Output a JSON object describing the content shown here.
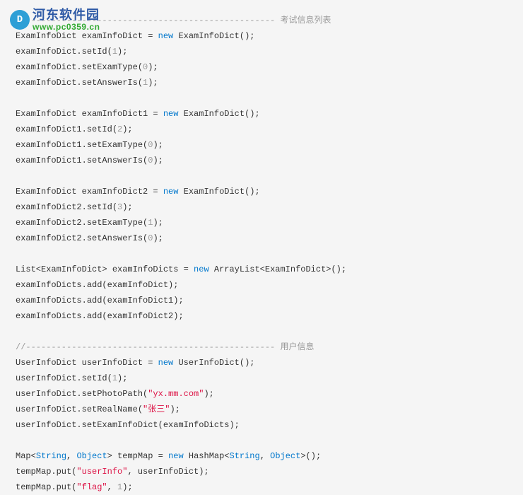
{
  "watermark": {
    "logo_glyph": "D",
    "title": "河东软件园",
    "url": "www.pc0359.cn"
  },
  "comments": {
    "exam_info": "//------------------------------------------------- 考试信息列表",
    "user_info": "//------------------------------------------------- 用户信息"
  },
  "lines": {
    "l1_a": "ExamInfoDict examInfoDict = ",
    "l1_new": "new",
    "l1_b": " ExamInfoDict();",
    "l2_a": "examInfoDict.setId(",
    "l2_n": "1",
    "l2_b": ");",
    "l3_a": "examInfoDict.setExamType(",
    "l3_n": "0",
    "l3_b": ");",
    "l4_a": "examInfoDict.setAnswerIs(",
    "l4_n": "1",
    "l4_b": ");",
    "l5_a": "ExamInfoDict examInfoDict1 = ",
    "l5_new": "new",
    "l5_b": " ExamInfoDict();",
    "l6_a": "examInfoDict1.setId(",
    "l6_n": "2",
    "l6_b": ");",
    "l7_a": "examInfoDict1.setExamType(",
    "l7_n": "0",
    "l7_b": ");",
    "l8_a": "examInfoDict1.setAnswerIs(",
    "l8_n": "0",
    "l8_b": ");",
    "l9_a": "ExamInfoDict examInfoDict2 = ",
    "l9_new": "new",
    "l9_b": " ExamInfoDict();",
    "l10_a": "examInfoDict2.setId(",
    "l10_n": "3",
    "l10_b": ");",
    "l11_a": "examInfoDict2.setExamType(",
    "l11_n": "1",
    "l11_b": ");",
    "l12_a": "examInfoDict2.setAnswerIs(",
    "l12_n": "0",
    "l12_b": ");",
    "l13_a": "List<ExamInfoDict> examInfoDicts = ",
    "l13_new": "new",
    "l13_b": " ArrayList<ExamInfoDict>();",
    "l14": "examInfoDicts.add(examInfoDict);",
    "l15": "examInfoDicts.add(examInfoDict1);",
    "l16": "examInfoDicts.add(examInfoDict2);",
    "u1_a": "UserInfoDict userInfoDict = ",
    "u1_new": "new",
    "u1_b": " UserInfoDict();",
    "u2_a": "userInfoDict.setId(",
    "u2_n": "1",
    "u2_b": ");",
    "u3_a": "userInfoDict.setPhotoPath(",
    "u3_s": "\"yx.mm.com\"",
    "u3_b": ");",
    "u4_a": "userInfoDict.setRealName(",
    "u4_s": "\"张三\"",
    "u4_b": ");",
    "u5": "userInfoDict.setExamInfoDict(examInfoDicts);",
    "m1_a": "Map<",
    "m1_t1": "String",
    "m1_b": ", ",
    "m1_t2": "Object",
    "m1_c": "> tempMap = ",
    "m1_new": "new",
    "m1_d": " HashMap<",
    "m1_t3": "String",
    "m1_e": ", ",
    "m1_t4": "Object",
    "m1_f": ">();",
    "m2_a": "tempMap.put(",
    "m2_s": "\"userInfo\"",
    "m2_b": ", userInfoDict);",
    "m3_a": "tempMap.put(",
    "m3_s": "\"flag\"",
    "m3_b": ", ",
    "m3_n": "1",
    "m3_c": ");"
  }
}
